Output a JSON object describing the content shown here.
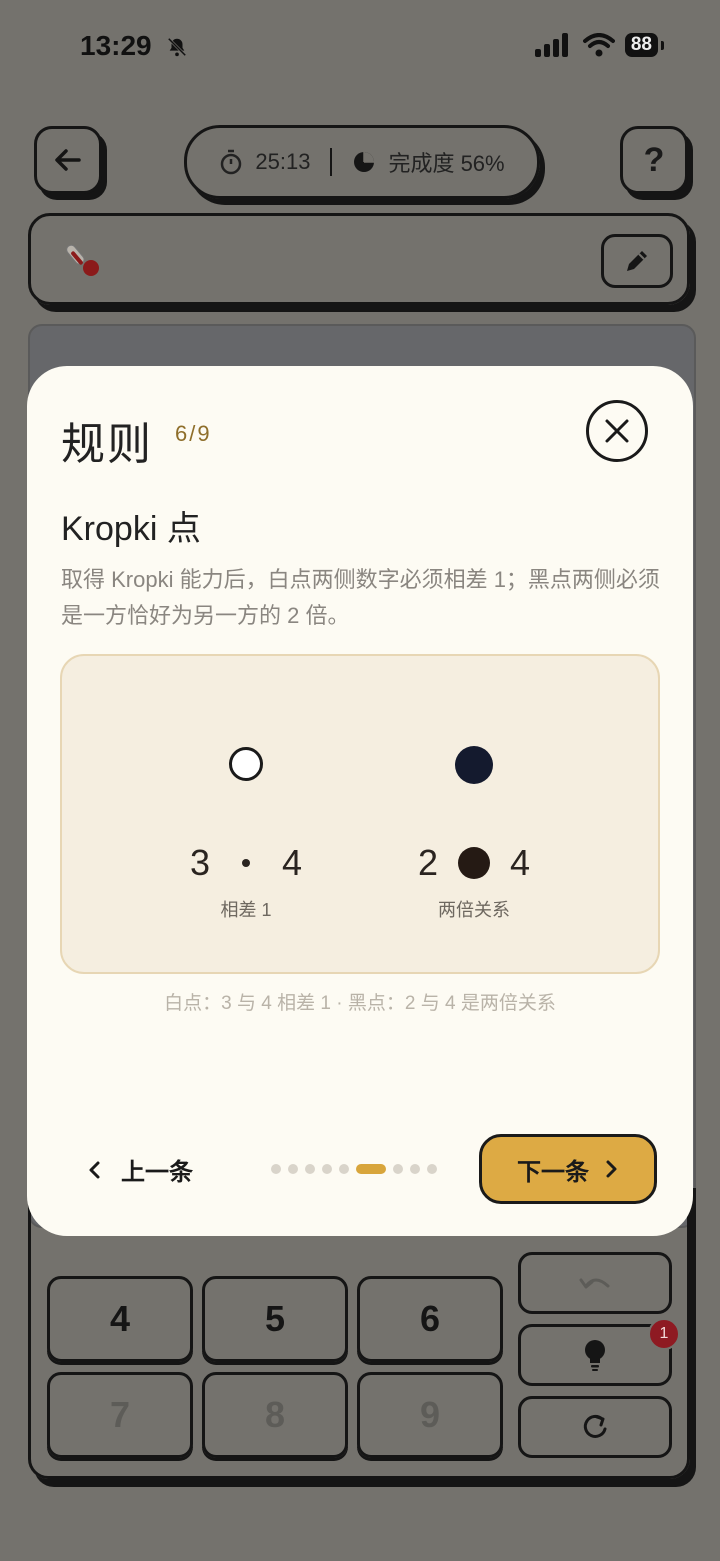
{
  "status_bar": {
    "time": "13:29",
    "battery": "88"
  },
  "header": {
    "timer": "25:13",
    "progress": "完成度 56%",
    "help_label": "?"
  },
  "keypad": {
    "keys": [
      "4",
      "5",
      "6",
      "7",
      "8",
      "9"
    ],
    "hint_count": "1"
  },
  "modal": {
    "title": "规则",
    "counter": "6/9",
    "rule_heading": "Kropki 点",
    "rule_description": "取得 Kropki 能力后，白点两侧数字必须相差 1；黑点两侧必须是一方恰好为另一方的 2 倍。",
    "examples": [
      {
        "a": "3",
        "b": "4",
        "caption": "相差 1"
      },
      {
        "a": "2",
        "b": "4",
        "caption": "两倍关系"
      }
    ],
    "illustration_caption": "白点：3 与 4 相差 1 · 黑点：2 与 4 是两倍关系",
    "prev_label": "上一条",
    "next_label": "下一条",
    "page_dots": {
      "total": 9,
      "current": 6
    }
  },
  "colors": {
    "accent": "#ddaa44",
    "modal_bg": "#fdfbf3",
    "badge": "#8e1a22",
    "black_dot": "#141a2e"
  }
}
